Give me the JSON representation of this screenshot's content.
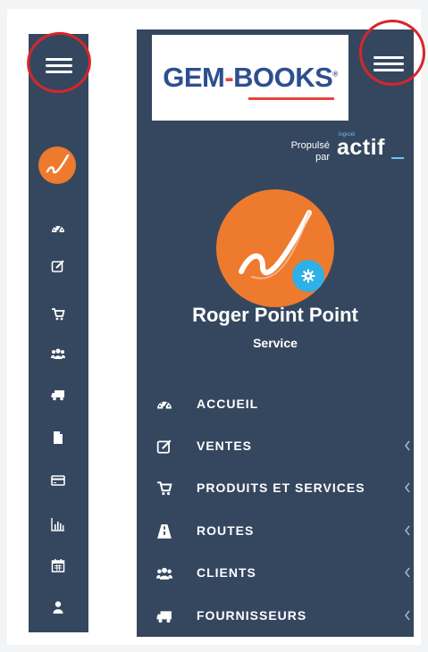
{
  "colors": {
    "sidebar_bg": "#35475f",
    "avatar_orange": "#ee7a2e",
    "badge_blue": "#2fb0e6",
    "highlight_red": "#d8262a",
    "logo_blue": "#2d4f8f",
    "logo_red": "#e8433a"
  },
  "collapsed_sidebar": {
    "menu_icon": "hamburger-icon",
    "avatar_icon": "swoosh-logo-icon",
    "icons": [
      "dashboard-icon",
      "edit-icon",
      "cart-icon",
      "users-icon",
      "truck-icon",
      "file-icon",
      "credit-card-icon",
      "bar-chart-icon",
      "calendar-icon",
      "user-icon"
    ]
  },
  "expanded_sidebar": {
    "logo": {
      "part1": "GEM",
      "dash": "-",
      "part2": "BOOKS",
      "tm": "®"
    },
    "powered": {
      "line1": "Propulsé",
      "line2": "par",
      "brand": "actif",
      "brand_small": "logiciel"
    },
    "user": {
      "name": "Roger Point Point",
      "role": "Service"
    },
    "menu": [
      {
        "label": "ACCUEIL",
        "icon": "dashboard-icon",
        "has_submenu": false
      },
      {
        "label": "VENTES",
        "icon": "edit-icon",
        "has_submenu": true
      },
      {
        "label": "PRODUITS ET SERVICES",
        "icon": "cart-icon",
        "has_submenu": true
      },
      {
        "label": "ROUTES",
        "icon": "road-icon",
        "has_submenu": true
      },
      {
        "label": "CLIENTS",
        "icon": "users-icon",
        "has_submenu": true
      },
      {
        "label": "FOURNISSEURS",
        "icon": "truck-icon",
        "has_submenu": true
      }
    ]
  }
}
